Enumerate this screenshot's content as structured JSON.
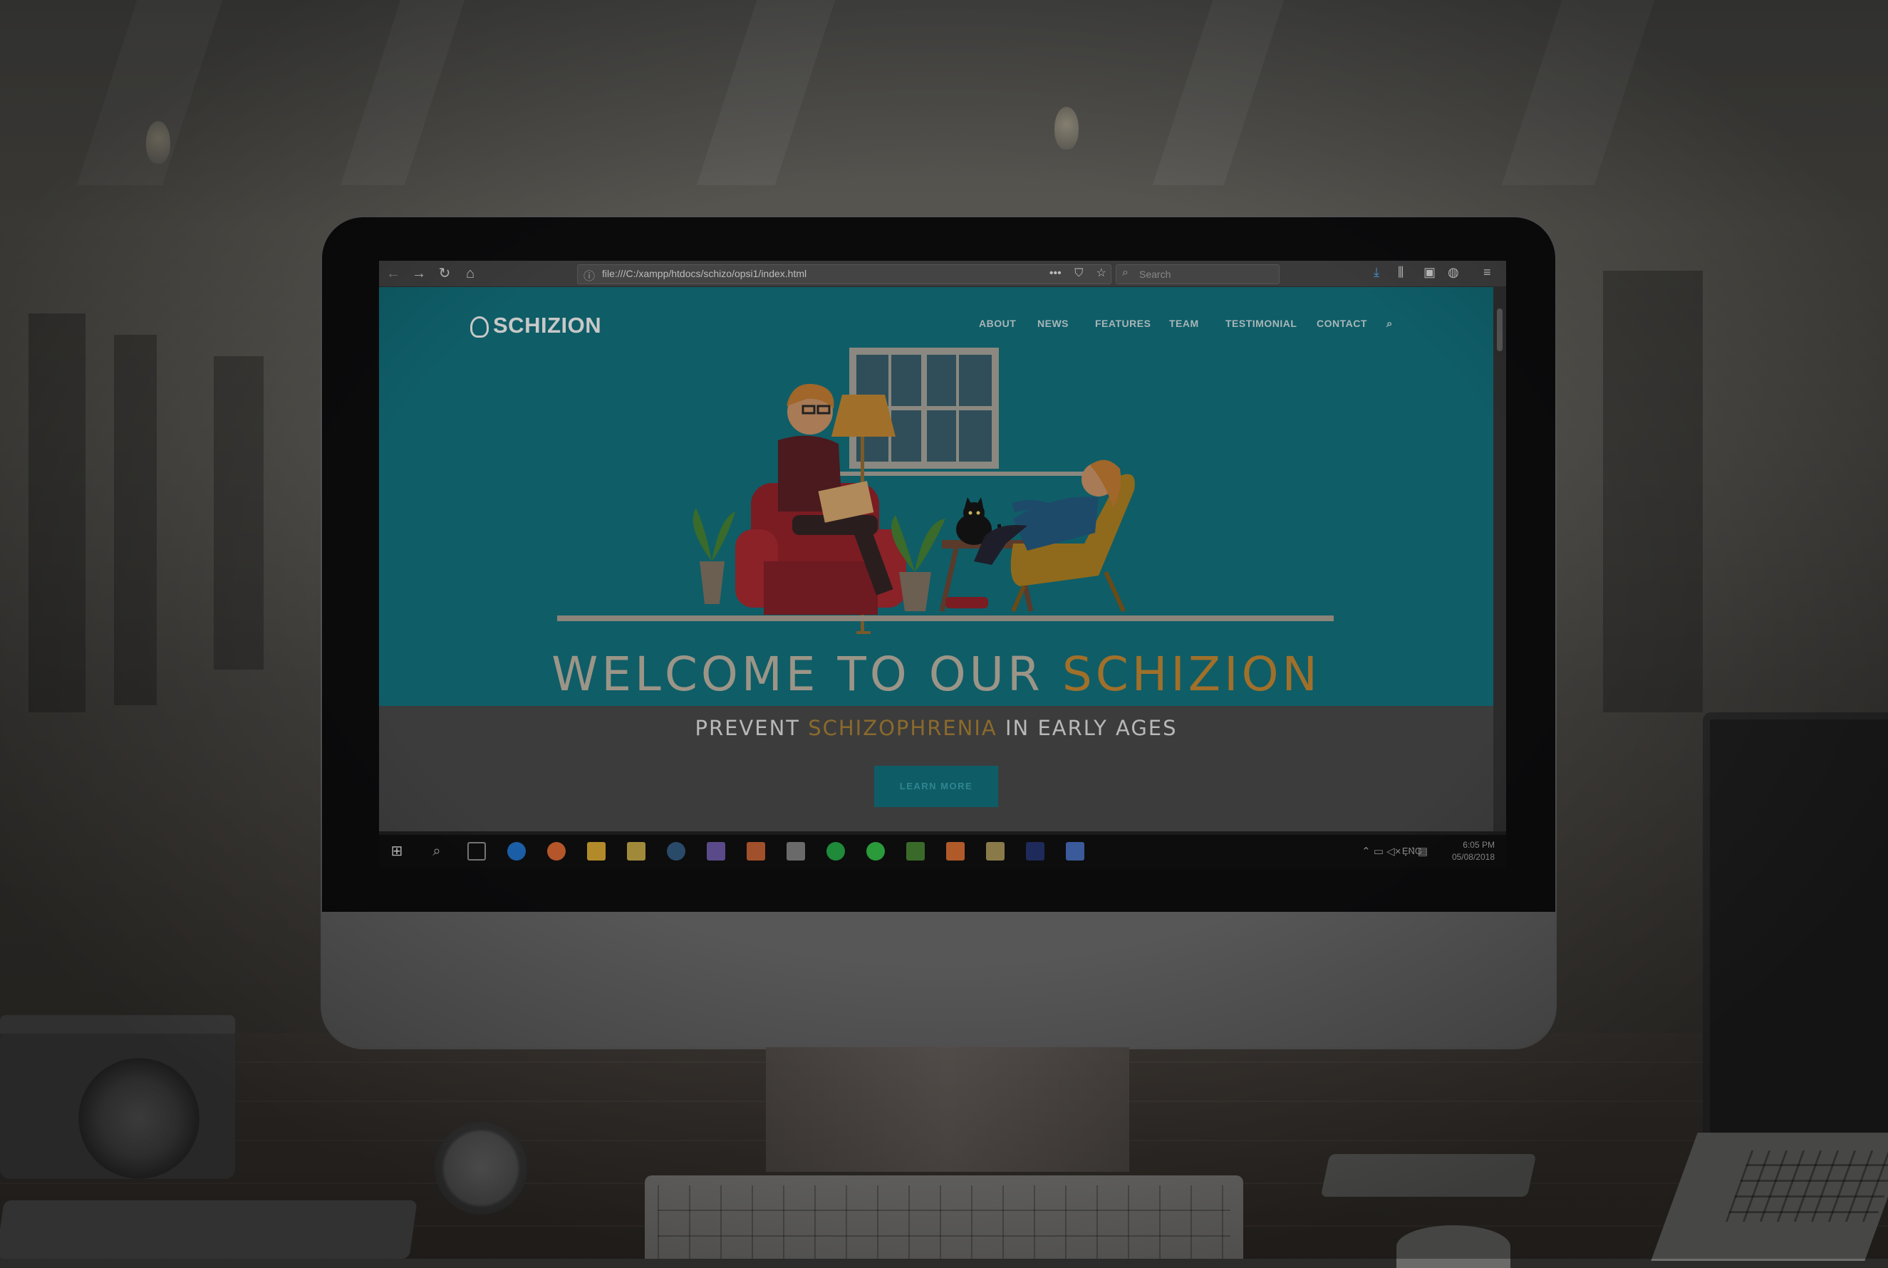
{
  "browser": {
    "url": "file:///C:/xampp/htdocs/schizo/opsi1/index.html",
    "search_placeholder": "Search",
    "page_actions": [
      "•••",
      "⛉",
      "☆"
    ]
  },
  "site": {
    "logo": "SCHIZION",
    "nav": [
      "ABOUT",
      "NEWS",
      "FEATURES",
      "TEAM",
      "TESTIMONIAL",
      "CONTACT"
    ],
    "hero_title_part1": "WELCOME TO OUR ",
    "hero_title_part2": "SCHIZION",
    "subheading_part1": "PREVENT ",
    "subheading_part2": "SCHIZOPHRENIA",
    "subheading_part3": " IN EARLY AGES",
    "cta_label": "LEARN MORE"
  },
  "taskbar": {
    "apps": [
      "start",
      "search",
      "task-view",
      "edge",
      "firefox",
      "file-explorer",
      "folder",
      "steam",
      "visual-studio",
      "matlab",
      "store",
      "spotify",
      "line",
      "sublime-text",
      "xampp",
      "photo-viewer",
      "photoshop",
      "notepad"
    ],
    "language": "ENG",
    "time": "6:05 PM",
    "date": "05/08/2018"
  },
  "colors": {
    "hero_bg": "#0f5d67",
    "accent": "#a0702a",
    "cta_bg": "#0e5d66"
  }
}
